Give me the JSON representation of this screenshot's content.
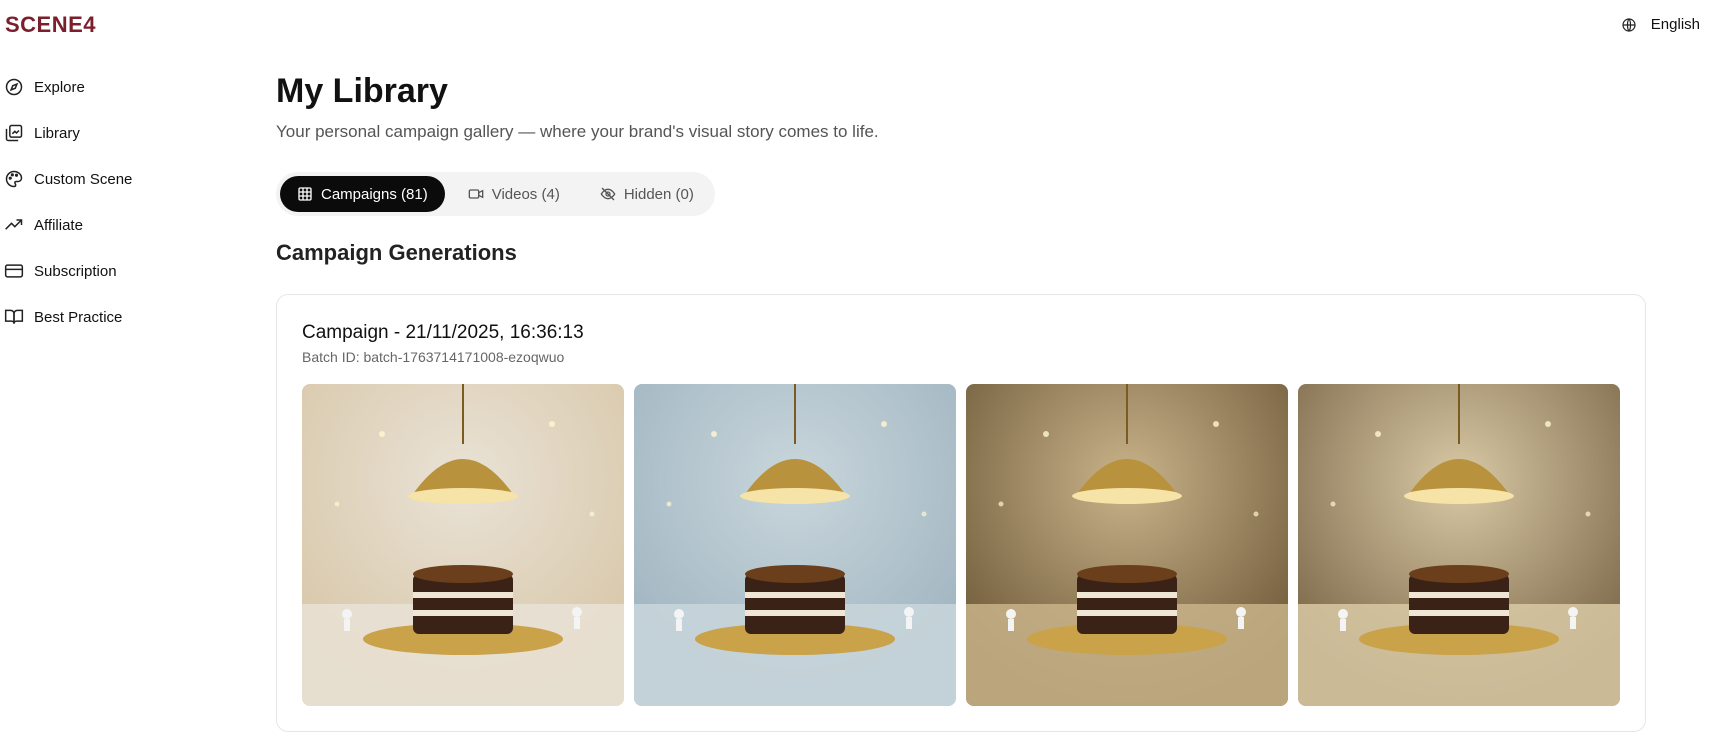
{
  "app": {
    "logo": "SCENE4"
  },
  "language": {
    "label": "English",
    "icon": "globe-icon"
  },
  "sidebar": {
    "items": [
      {
        "label": "Explore",
        "icon": "compass-icon"
      },
      {
        "label": "Library",
        "icon": "library-icon"
      },
      {
        "label": "Custom Scene",
        "icon": "palette-icon"
      },
      {
        "label": "Affiliate",
        "icon": "trending-up-icon"
      },
      {
        "label": "Subscription",
        "icon": "credit-card-icon"
      },
      {
        "label": "Best Practice",
        "icon": "book-open-icon"
      }
    ]
  },
  "page": {
    "title": "My Library",
    "subtitle": "Your personal campaign gallery — where your brand's visual story comes to life."
  },
  "tabs": [
    {
      "label": "Campaigns (81)",
      "icon": "grid-icon",
      "active": true
    },
    {
      "label": "Videos (4)",
      "icon": "video-icon",
      "active": false
    },
    {
      "label": "Hidden (0)",
      "icon": "eye-off-icon",
      "active": false
    }
  ],
  "section": {
    "title": "Campaign Generations"
  },
  "campaign": {
    "title": "Campaign - 21/11/2025, 16:36:13",
    "batch": "Batch ID: batch-1763714171008-ezoqwuo",
    "images": [
      {
        "alt": "cake-under-golden-cloche-1",
        "palette": [
          "#d8c7a8",
          "#8a6a3c",
          "#e9e2d6"
        ]
      },
      {
        "alt": "cake-under-golden-cloche-2",
        "palette": [
          "#9fb4c0",
          "#6d8796",
          "#c9d6dc"
        ]
      },
      {
        "alt": "cake-under-golden-cloche-3",
        "palette": [
          "#6f5a3a",
          "#3d3226",
          "#c8b38a"
        ]
      },
      {
        "alt": "cake-under-golden-cloche-4",
        "palette": [
          "#7a6648",
          "#3c3227",
          "#d9c9a5"
        ]
      }
    ]
  },
  "colors": {
    "accent": "#0b0b0b",
    "logo": "#7a1f2b"
  }
}
